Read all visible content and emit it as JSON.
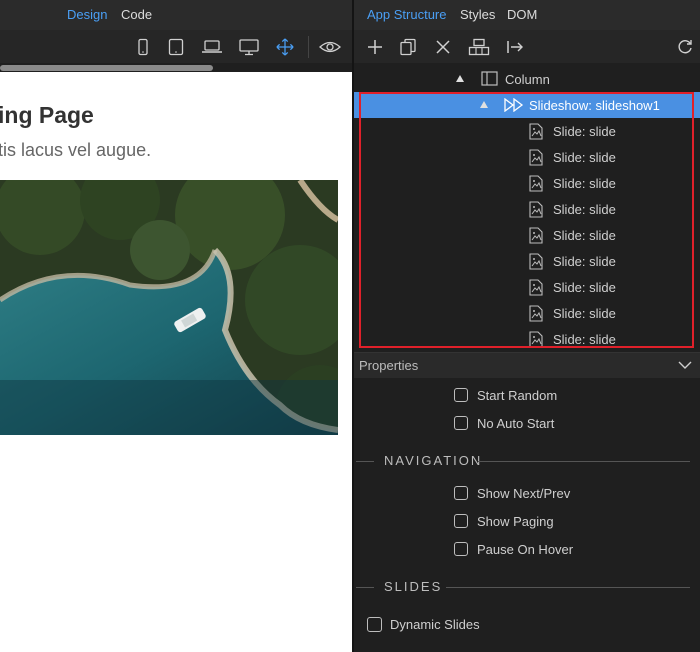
{
  "left_tabs": {
    "design": "Design",
    "code": "Code"
  },
  "left_toolbar": {
    "icons": [
      "phone-icon",
      "tablet-icon",
      "laptop-icon",
      "desktop-icon",
      "move-arrows-icon",
      "eye-icon"
    ]
  },
  "canvas": {
    "title": "ing Page",
    "text": "tis lacus vel augue.",
    "image": "aerial-coast-boat-image"
  },
  "right_tabs": {
    "app_structure": "App Structure",
    "styles": "Styles",
    "dom": "DOM"
  },
  "right_toolbar": {
    "icons": [
      "add-icon",
      "duplicate-icon",
      "delete-icon",
      "component-icon",
      "insert-after-icon",
      "refresh-icon"
    ]
  },
  "tree": {
    "column": "Column",
    "slideshow": "Slideshow: slideshow1",
    "slides": [
      "Slide: slide",
      "Slide: slide",
      "Slide: slide",
      "Slide: slide",
      "Slide: slide",
      "Slide: slide",
      "Slide: slide",
      "Slide: slide",
      "Slide: slide"
    ]
  },
  "properties": {
    "title": "Properties",
    "options_top": [
      "Start Random",
      "No Auto Start"
    ],
    "navigation_title": "NAVIGATION",
    "navigation_options": [
      "Show Next/Prev",
      "Show Paging",
      "Pause On Hover"
    ],
    "slides_title": "SLIDES",
    "slides_options": [
      "Dynamic Slides"
    ]
  },
  "colors": {
    "accent": "#4a90e2",
    "highlight_border": "#e0202a",
    "tab_active": "#4a9ff5"
  }
}
